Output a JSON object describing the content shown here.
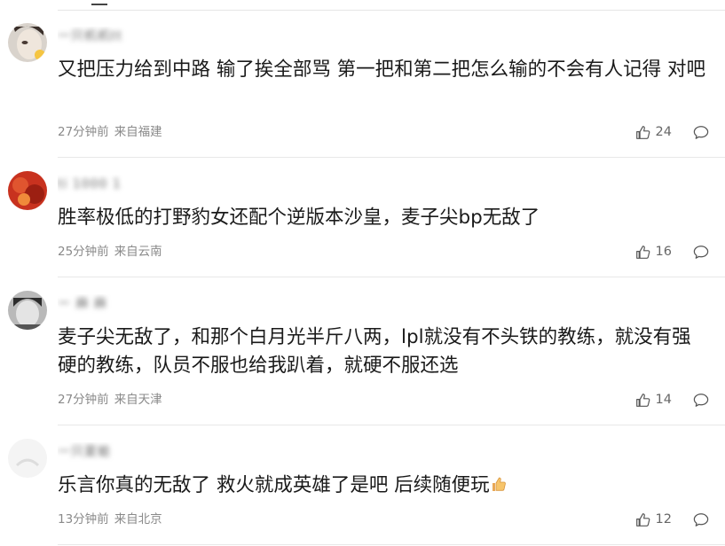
{
  "comments": [
    {
      "username": "一只机机tt",
      "text": "又把压力给到中路 输了挨全部骂 第一把和第二把怎么输的不会有人记得 对吧",
      "time": "27分钟前",
      "location": "来自福建",
      "likes": "24"
    },
    {
      "username": "ti 1000 1",
      "text": "胜率极低的打野豹女还配个逆版本沙皇，麦子尖bp无敌了",
      "time": "25分钟前",
      "location": "来自云南",
      "likes": "16"
    },
    {
      "username": "ー 麻 麻",
      "text": "麦子尖无敌了，和那个白月光半斤八两，lpl就没有不头铁的教练，就没有强硬的教练，队员不服也给我趴着，就硬不服还选",
      "time": "27分钟前",
      "location": "来自天津",
      "likes": "14"
    },
    {
      "username": "一只夏蛤",
      "text": "乐言你真的无敌了 救火就成英雄了是吧 后续随便玩",
      "time": "13分钟前",
      "location": "来自北京",
      "likes": "12"
    }
  ],
  "icons": {
    "like": "thumbs-up-icon",
    "reply": "speech-bubble-icon",
    "emoji": "thumbs-up-emoji"
  }
}
